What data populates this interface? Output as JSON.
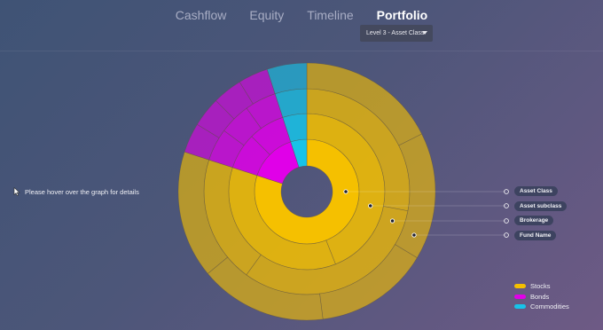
{
  "nav": {
    "tabs": [
      {
        "label": "Cashflow",
        "active": false
      },
      {
        "label": "Equity",
        "active": false
      },
      {
        "label": "Timeline",
        "active": false
      },
      {
        "label": "Portfolio",
        "active": true
      }
    ]
  },
  "level_selector": {
    "value": "Level 3 - Asset Class"
  },
  "hint": {
    "text": "Please hover over the  graph for details"
  },
  "levels": [
    "Asset Class",
    "Asset subclass",
    "Brokerage",
    "Fund Name"
  ],
  "legend": [
    {
      "label": "Stocks",
      "color": "#f5c000"
    },
    {
      "label": "Bonds",
      "color": "#e000e8"
    },
    {
      "label": "Commodities",
      "color": "#17c3e8"
    }
  ],
  "chart_data": {
    "type": "sunburst",
    "rings": [
      "Asset Class",
      "Asset subclass",
      "Brokerage",
      "Fund Name"
    ],
    "categories": [
      "Stocks",
      "Bonds",
      "Commodities"
    ],
    "shares_percent": {
      "Stocks": 80,
      "Bonds": 15,
      "Commodities": 5
    },
    "colors": {
      "Stocks": "#f5c000",
      "Bonds": "#e000e8",
      "Commodities": "#17c3e8"
    }
  }
}
